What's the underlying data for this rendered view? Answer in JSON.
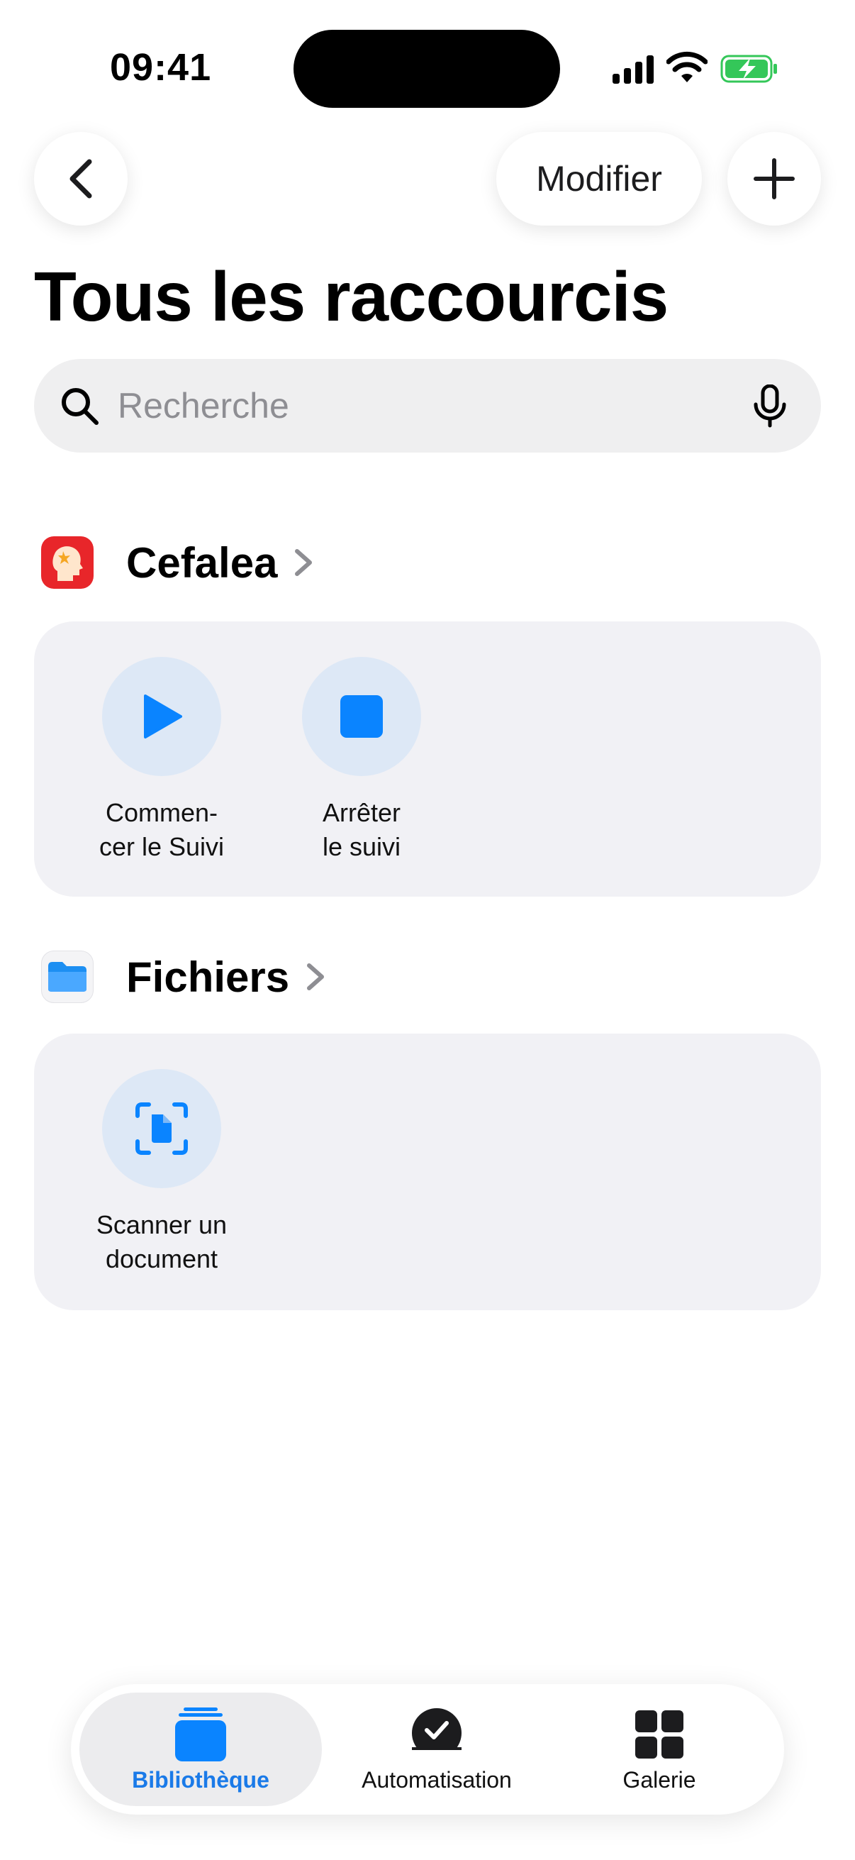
{
  "status_bar": {
    "time": "09:41"
  },
  "nav": {
    "edit_label": "Modifier"
  },
  "page": {
    "title": "Tous les raccourcis"
  },
  "search": {
    "placeholder": "Recherche"
  },
  "sections": [
    {
      "name": "Cefalea",
      "shortcuts": [
        {
          "label": "Commen-\ncer le Suivi",
          "icon": "play-icon"
        },
        {
          "label": "Arrêter\nle suivi",
          "icon": "stop-icon"
        }
      ]
    },
    {
      "name": "Fichiers",
      "shortcuts": [
        {
          "label": "Scanner un\ndocument",
          "icon": "scan-document-icon"
        }
      ]
    }
  ],
  "tabbar": {
    "tabs": [
      {
        "label": "Bibliothèque",
        "icon": "library-icon",
        "selected": true
      },
      {
        "label": "Automatisation",
        "icon": "automation-icon",
        "selected": false
      },
      {
        "label": "Galerie",
        "icon": "gallery-icon",
        "selected": false
      }
    ]
  },
  "colors": {
    "accent": "#0a84ff",
    "card_bg": "#f1f1f5",
    "bubble_bg": "#dde8f6",
    "battery_green": "#34c759",
    "cefalea_red": "#e8262a"
  }
}
